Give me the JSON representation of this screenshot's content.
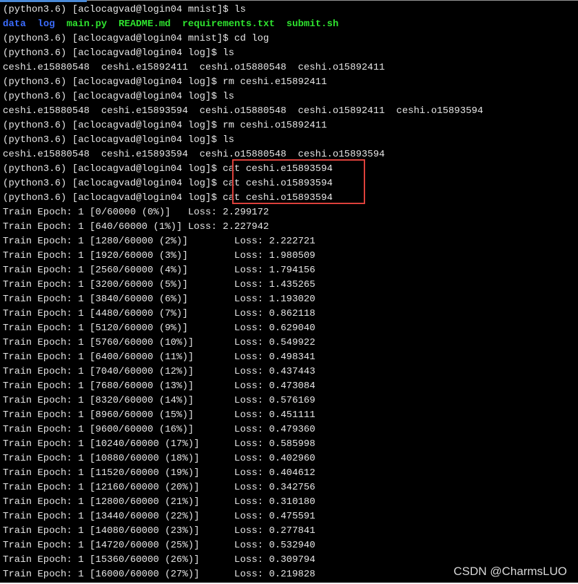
{
  "terminal": {
    "lines": [
      {
        "type": "text",
        "text": "(python3.6) [aclocagvad@login04 mnist]$ ls"
      },
      {
        "type": "ls",
        "items": [
          {
            "name": "data",
            "color": "blue"
          },
          {
            "name": "log",
            "color": "blue"
          },
          {
            "name": "main.py",
            "color": "green"
          },
          {
            "name": "README.md",
            "color": "green"
          },
          {
            "name": "requirements.txt",
            "color": "green"
          },
          {
            "name": "submit.sh",
            "color": "green"
          }
        ]
      },
      {
        "type": "text",
        "text": "(python3.6) [aclocagvad@login04 mnist]$ cd log"
      },
      {
        "type": "text",
        "text": "(python3.6) [aclocagvad@login04 log]$ ls"
      },
      {
        "type": "text",
        "text": "ceshi.e15880548  ceshi.e15892411  ceshi.o15880548  ceshi.o15892411"
      },
      {
        "type": "text",
        "text": "(python3.6) [aclocagvad@login04 log]$ rm ceshi.e15892411"
      },
      {
        "type": "text",
        "text": "(python3.6) [aclocagvad@login04 log]$ ls"
      },
      {
        "type": "text",
        "text": "ceshi.e15880548  ceshi.e15893594  ceshi.o15880548  ceshi.o15892411  ceshi.o15893594"
      },
      {
        "type": "text",
        "text": "(python3.6) [aclocagvad@login04 log]$ rm ceshi.o15892411"
      },
      {
        "type": "text",
        "text": "(python3.6) [aclocagvad@login04 log]$ ls"
      },
      {
        "type": "text",
        "text": "ceshi.e15880548  ceshi.e15893594  ceshi.o15880548  ceshi.o15893594"
      },
      {
        "type": "text",
        "text": "(python3.6) [aclocagvad@login04 log]$ cat ceshi.e15893594"
      },
      {
        "type": "text",
        "text": "(python3.6) [aclocagvad@login04 log]$ cat ceshi.o15893594"
      },
      {
        "type": "text",
        "text": "(python3.6) [aclocagvad@login04 log]$ cat ceshi.o15893594"
      },
      {
        "type": "text",
        "text": "Train Epoch: 1 [0/60000 (0%)]   Loss: 2.299172"
      },
      {
        "type": "text",
        "text": "Train Epoch: 1 [640/60000 (1%)] Loss: 2.227942"
      },
      {
        "type": "text",
        "text": "Train Epoch: 1 [1280/60000 (2%)]        Loss: 2.222721"
      },
      {
        "type": "text",
        "text": "Train Epoch: 1 [1920/60000 (3%)]        Loss: 1.980509"
      },
      {
        "type": "text",
        "text": "Train Epoch: 1 [2560/60000 (4%)]        Loss: 1.794156"
      },
      {
        "type": "text",
        "text": "Train Epoch: 1 [3200/60000 (5%)]        Loss: 1.435265"
      },
      {
        "type": "text",
        "text": "Train Epoch: 1 [3840/60000 (6%)]        Loss: 1.193020"
      },
      {
        "type": "text",
        "text": "Train Epoch: 1 [4480/60000 (7%)]        Loss: 0.862118"
      },
      {
        "type": "text",
        "text": "Train Epoch: 1 [5120/60000 (9%)]        Loss: 0.629040"
      },
      {
        "type": "text",
        "text": "Train Epoch: 1 [5760/60000 (10%)]       Loss: 0.549922"
      },
      {
        "type": "text",
        "text": "Train Epoch: 1 [6400/60000 (11%)]       Loss: 0.498341"
      },
      {
        "type": "text",
        "text": "Train Epoch: 1 [7040/60000 (12%)]       Loss: 0.437443"
      },
      {
        "type": "text",
        "text": "Train Epoch: 1 [7680/60000 (13%)]       Loss: 0.473084"
      },
      {
        "type": "text",
        "text": "Train Epoch: 1 [8320/60000 (14%)]       Loss: 0.576169"
      },
      {
        "type": "text",
        "text": "Train Epoch: 1 [8960/60000 (15%)]       Loss: 0.451111"
      },
      {
        "type": "text",
        "text": "Train Epoch: 1 [9600/60000 (16%)]       Loss: 0.479360"
      },
      {
        "type": "text",
        "text": "Train Epoch: 1 [10240/60000 (17%)]      Loss: 0.585998"
      },
      {
        "type": "text",
        "text": "Train Epoch: 1 [10880/60000 (18%)]      Loss: 0.402960"
      },
      {
        "type": "text",
        "text": "Train Epoch: 1 [11520/60000 (19%)]      Loss: 0.404612"
      },
      {
        "type": "text",
        "text": "Train Epoch: 1 [12160/60000 (20%)]      Loss: 0.342756"
      },
      {
        "type": "text",
        "text": "Train Epoch: 1 [12800/60000 (21%)]      Loss: 0.310180"
      },
      {
        "type": "text",
        "text": "Train Epoch: 1 [13440/60000 (22%)]      Loss: 0.475591"
      },
      {
        "type": "text",
        "text": "Train Epoch: 1 [14080/60000 (23%)]      Loss: 0.277841"
      },
      {
        "type": "text",
        "text": "Train Epoch: 1 [14720/60000 (25%)]      Loss: 0.532940"
      },
      {
        "type": "text",
        "text": "Train Epoch: 1 [15360/60000 (26%)]      Loss: 0.309794"
      },
      {
        "type": "text",
        "text": "Train Epoch: 1 [16000/60000 (27%)]      Loss: 0.219828"
      }
    ]
  },
  "watermark": "CSDN @CharmsLUO",
  "colors": {
    "background": "#000000",
    "text": "#e6e6e6",
    "directory": "#3b6cff",
    "executable": "#2fe42f",
    "highlight_border": "#e0413c"
  }
}
